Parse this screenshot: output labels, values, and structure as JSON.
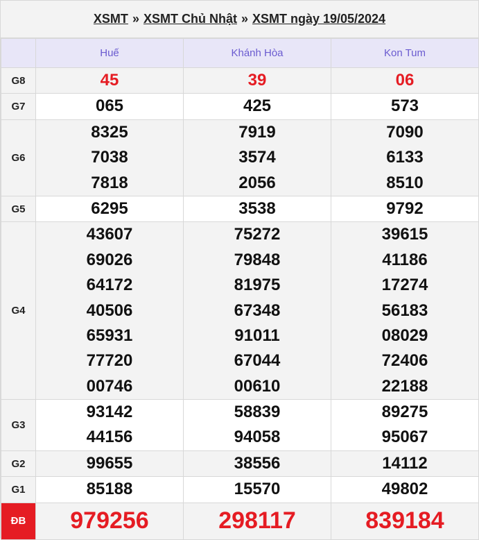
{
  "breadcrumb": {
    "item1": "XSMT",
    "sep": "»",
    "item2": "XSMT Chủ Nhật",
    "item3": "XSMT ngày 19/05/2024"
  },
  "provinces": [
    "Huế",
    "Khánh Hòa",
    "Kon Tum"
  ],
  "prizes": [
    {
      "label": "G8",
      "values": [
        [
          "45"
        ],
        [
          "39"
        ],
        [
          "06"
        ]
      ]
    },
    {
      "label": "G7",
      "values": [
        [
          "065"
        ],
        [
          "425"
        ],
        [
          "573"
        ]
      ]
    },
    {
      "label": "G6",
      "values": [
        [
          "8325",
          "7038",
          "7818"
        ],
        [
          "7919",
          "3574",
          "2056"
        ],
        [
          "7090",
          "6133",
          "8510"
        ]
      ]
    },
    {
      "label": "G5",
      "values": [
        [
          "6295"
        ],
        [
          "3538"
        ],
        [
          "9792"
        ]
      ]
    },
    {
      "label": "G4",
      "values": [
        [
          "43607",
          "69026",
          "64172",
          "40506",
          "65931",
          "77720",
          "00746"
        ],
        [
          "75272",
          "79848",
          "81975",
          "67348",
          "91011",
          "67044",
          "00610"
        ],
        [
          "39615",
          "41186",
          "17274",
          "56183",
          "08029",
          "72406",
          "22188"
        ]
      ]
    },
    {
      "label": "G3",
      "values": [
        [
          "93142",
          "44156"
        ],
        [
          "58839",
          "94058"
        ],
        [
          "89275",
          "95067"
        ]
      ]
    },
    {
      "label": "G2",
      "values": [
        [
          "99655"
        ],
        [
          "38556"
        ],
        [
          "14112"
        ]
      ]
    },
    {
      "label": "G1",
      "values": [
        [
          "85188"
        ],
        [
          "15570"
        ],
        [
          "49802"
        ]
      ]
    }
  ],
  "special": {
    "label": "ĐB",
    "values": [
      "979256",
      "298117",
      "839184"
    ]
  },
  "colors": {
    "accent_red": "#e51c23",
    "header_purple": "#6a5bd0"
  }
}
